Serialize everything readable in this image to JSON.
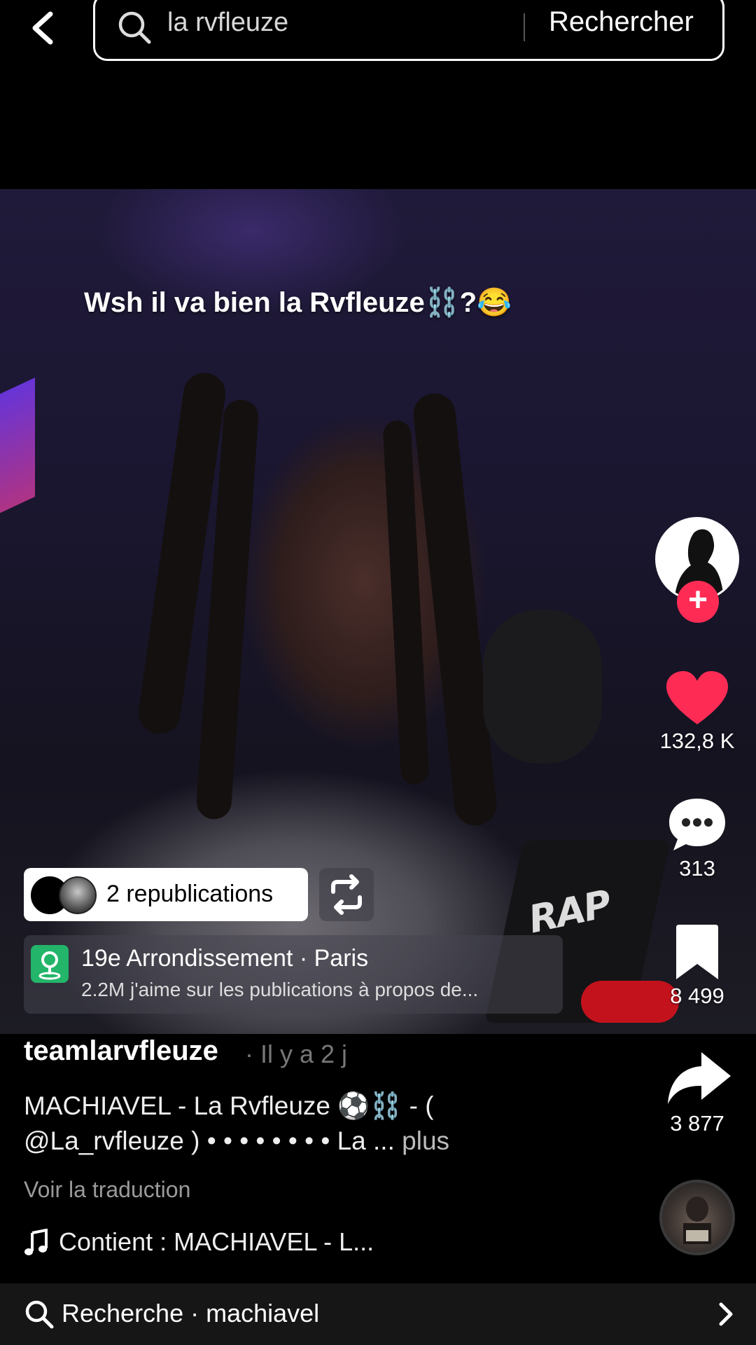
{
  "search": {
    "query": "la rvfleuze",
    "submit_label": "Rechercher"
  },
  "video": {
    "caption": "Wsh il va bien la Rvfleuze⛓️?😂",
    "mic_logo": "RAP"
  },
  "rail": {
    "likes": "132,8 K",
    "comments": "313",
    "saves": "8 499",
    "shares": "3 877",
    "like_color": "#fe2c55"
  },
  "republications": {
    "label": "2 republications"
  },
  "location": {
    "title": "19e Arrondissement · Paris",
    "subtitle": "2.2M j'aime sur les publications à propos de..."
  },
  "post": {
    "username": "teamlarvfleuze",
    "time": "· Il y a 2 j",
    "description": "MACHIAVEL - La Rvfleuze ⚽⛓️ - ( @La_rvfleuze ) • • • • • • • • La ...",
    "more_label": "plus",
    "translate_label": "Voir la traduction",
    "music_label": "Contient : MACHIAVEL - L..."
  },
  "bottom_bar": {
    "label": "Recherche · machiavel"
  }
}
